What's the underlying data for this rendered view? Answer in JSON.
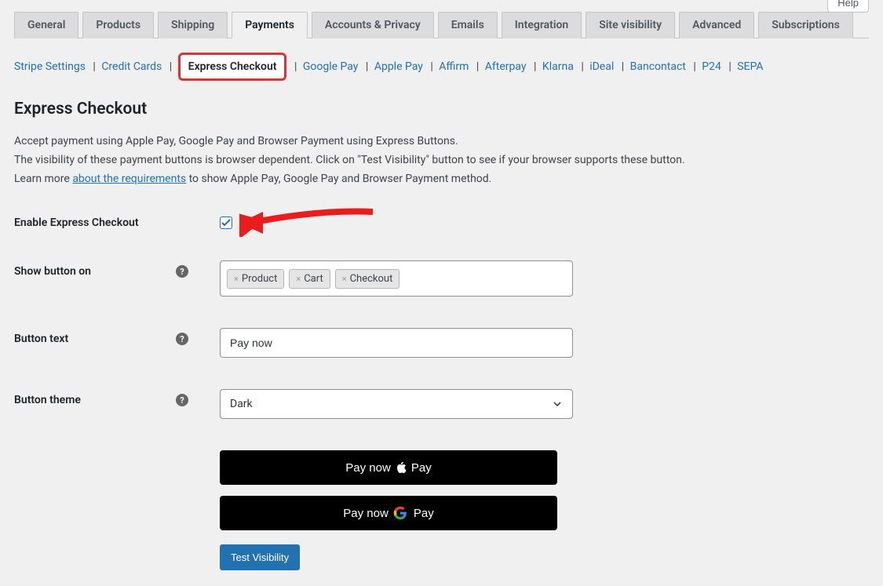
{
  "help_button": "Help",
  "tabs": {
    "general": "General",
    "products": "Products",
    "shipping": "Shipping",
    "payments": "Payments",
    "accounts": "Accounts & Privacy",
    "emails": "Emails",
    "integration": "Integration",
    "site_visibility": "Site visibility",
    "advanced": "Advanced",
    "subscriptions": "Subscriptions"
  },
  "subnav": {
    "stripe_settings": "Stripe Settings",
    "credit_cards": "Credit Cards",
    "express_checkout": "Express Checkout",
    "google_pay": "Google Pay",
    "apple_pay": "Apple Pay",
    "affirm": "Affirm",
    "afterpay": "Afterpay",
    "klarna": "Klarna",
    "ideal": "iDeal",
    "bancontact": "Bancontact",
    "p24": "P24",
    "sepa": "SEPA"
  },
  "page_title": "Express Checkout",
  "description": {
    "line1": "Accept payment using Apple Pay, Google Pay and Browser Payment using Express Buttons.",
    "line2": "The visibility of these payment buttons is browser dependent. Click on \"Test Visibility\" button to see if your browser supports these button.",
    "line3_prefix": "Learn more ",
    "line3_link": "about the requirements",
    "line3_suffix": " to show Apple Pay, Google Pay and Browser Payment method."
  },
  "form": {
    "enable_label": "Enable Express Checkout",
    "enable_checked": true,
    "show_button_label": "Show button on",
    "tags": {
      "product": "Product",
      "cart": "Cart",
      "checkout": "Checkout"
    },
    "button_text_label": "Button text",
    "button_text_value": "Pay now",
    "button_theme_label": "Button theme",
    "button_theme_value": "Dark"
  },
  "preview": {
    "pay_now": "Pay now",
    "pay_word": "Pay"
  },
  "test_visibility": "Test Visibility"
}
